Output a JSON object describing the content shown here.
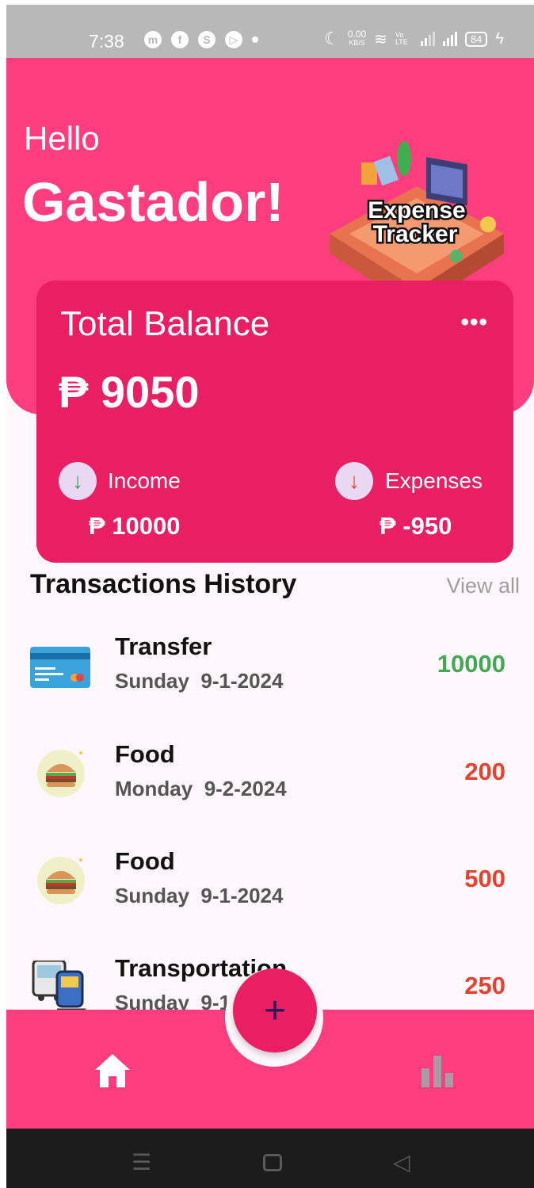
{
  "status_bar": {
    "time": "7:38",
    "net_speed_value": "0.00",
    "net_speed_unit": "KB/S",
    "volte": "Vo LTE",
    "battery": "84"
  },
  "header": {
    "greeting": "Hello",
    "name": "Gastador!",
    "logo_line1": "Expense",
    "logo_line2": "Tracker"
  },
  "balance_card": {
    "title": "Total Balance",
    "menu": "•••",
    "balance": "₱ 9050",
    "income_label": "Income",
    "income_value": "₱ 10000",
    "expenses_label": "Expenses",
    "expenses_value": "₱ -950",
    "income_icon": "arrow-down-icon",
    "expense_icon": "arrow-down-icon"
  },
  "transactions": {
    "title": "Transactions History",
    "view_all": "View all",
    "items": [
      {
        "name": "Transfer",
        "day": "Sunday",
        "date": "9-1-2024",
        "amount": "10000",
        "icon": "credit-card-icon",
        "color": "#43a853"
      },
      {
        "name": "Food",
        "day": "Monday",
        "date": "9-2-2024",
        "amount": "200",
        "icon": "burger-icon",
        "color": "#e5432f"
      },
      {
        "name": "Food",
        "day": "Sunday",
        "date": "9-1-2024",
        "amount": "500",
        "icon": "burger-icon",
        "color": "#e5432f"
      },
      {
        "name": "Transportation",
        "day": "Sunday",
        "date": "9-1-",
        "amount": "250",
        "icon": "bus-train-icon",
        "color": "#e5432f"
      }
    ]
  },
  "bottom_nav": {
    "fab_label": "+",
    "home_icon": "home-icon",
    "stats_icon": "bar-chart-icon"
  },
  "colors": {
    "primary": "#fd3d7d",
    "card": "#e91e63",
    "income": "#43a853",
    "expense": "#e5432f"
  }
}
